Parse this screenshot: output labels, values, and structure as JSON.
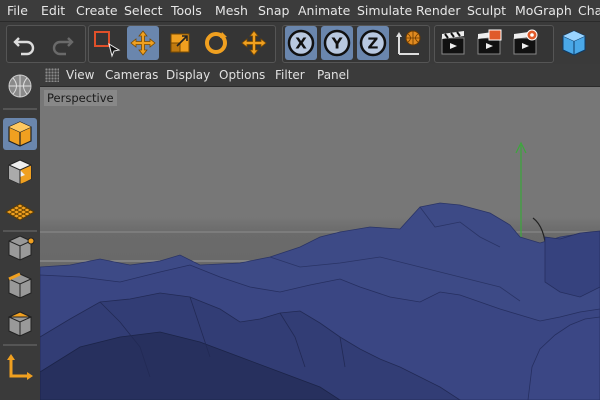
{
  "menu": [
    "File",
    "Edit",
    "Create",
    "Select",
    "Tools",
    "Mesh",
    "Snap",
    "Animate",
    "Simulate",
    "Render",
    "Sculpt",
    "MoGraph",
    "Cha"
  ],
  "toolbar": {
    "axes": {
      "x": "X",
      "y": "Y",
      "z": "Z"
    }
  },
  "viewport_menu": [
    "View",
    "Cameras",
    "Display",
    "Options",
    "Filter",
    "Panel"
  ],
  "viewport": {
    "label": "Perspective"
  },
  "colors": {
    "accent": "#6a86ad",
    "mesh": "#3e4b87",
    "axis_y": "#3ba83b",
    "orange": "#f0a020"
  }
}
